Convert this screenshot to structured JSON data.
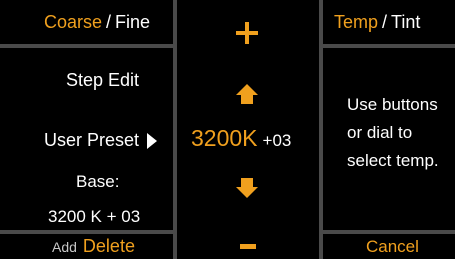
{
  "colors": {
    "accent": "#f0a01e",
    "text": "#ffffff",
    "muted": "#c8c8c8",
    "divider": "#4a4a4a",
    "background": "#000000"
  },
  "left_panel": {
    "header_active": "Coarse",
    "header_separator": "/",
    "header_inactive": "Fine",
    "step_edit_label": "Step Edit",
    "user_preset_label": "User Preset",
    "base_label": "Base:",
    "base_value": "3200 K + 03",
    "add_label": "Add",
    "delete_label": "Delete"
  },
  "center_panel": {
    "increase_icon": "plus-icon",
    "up_icon": "arrow-up-icon",
    "temperature_value": "3200K",
    "tint_value": "+03",
    "down_icon": "arrow-down-icon",
    "decrease_icon": "minus-icon"
  },
  "right_panel": {
    "header_active": "Temp",
    "header_separator": "/",
    "header_inactive": "Tint",
    "info_lines": [
      "Use buttons",
      "or dial to",
      "select temp."
    ],
    "cancel_label": "Cancel"
  }
}
